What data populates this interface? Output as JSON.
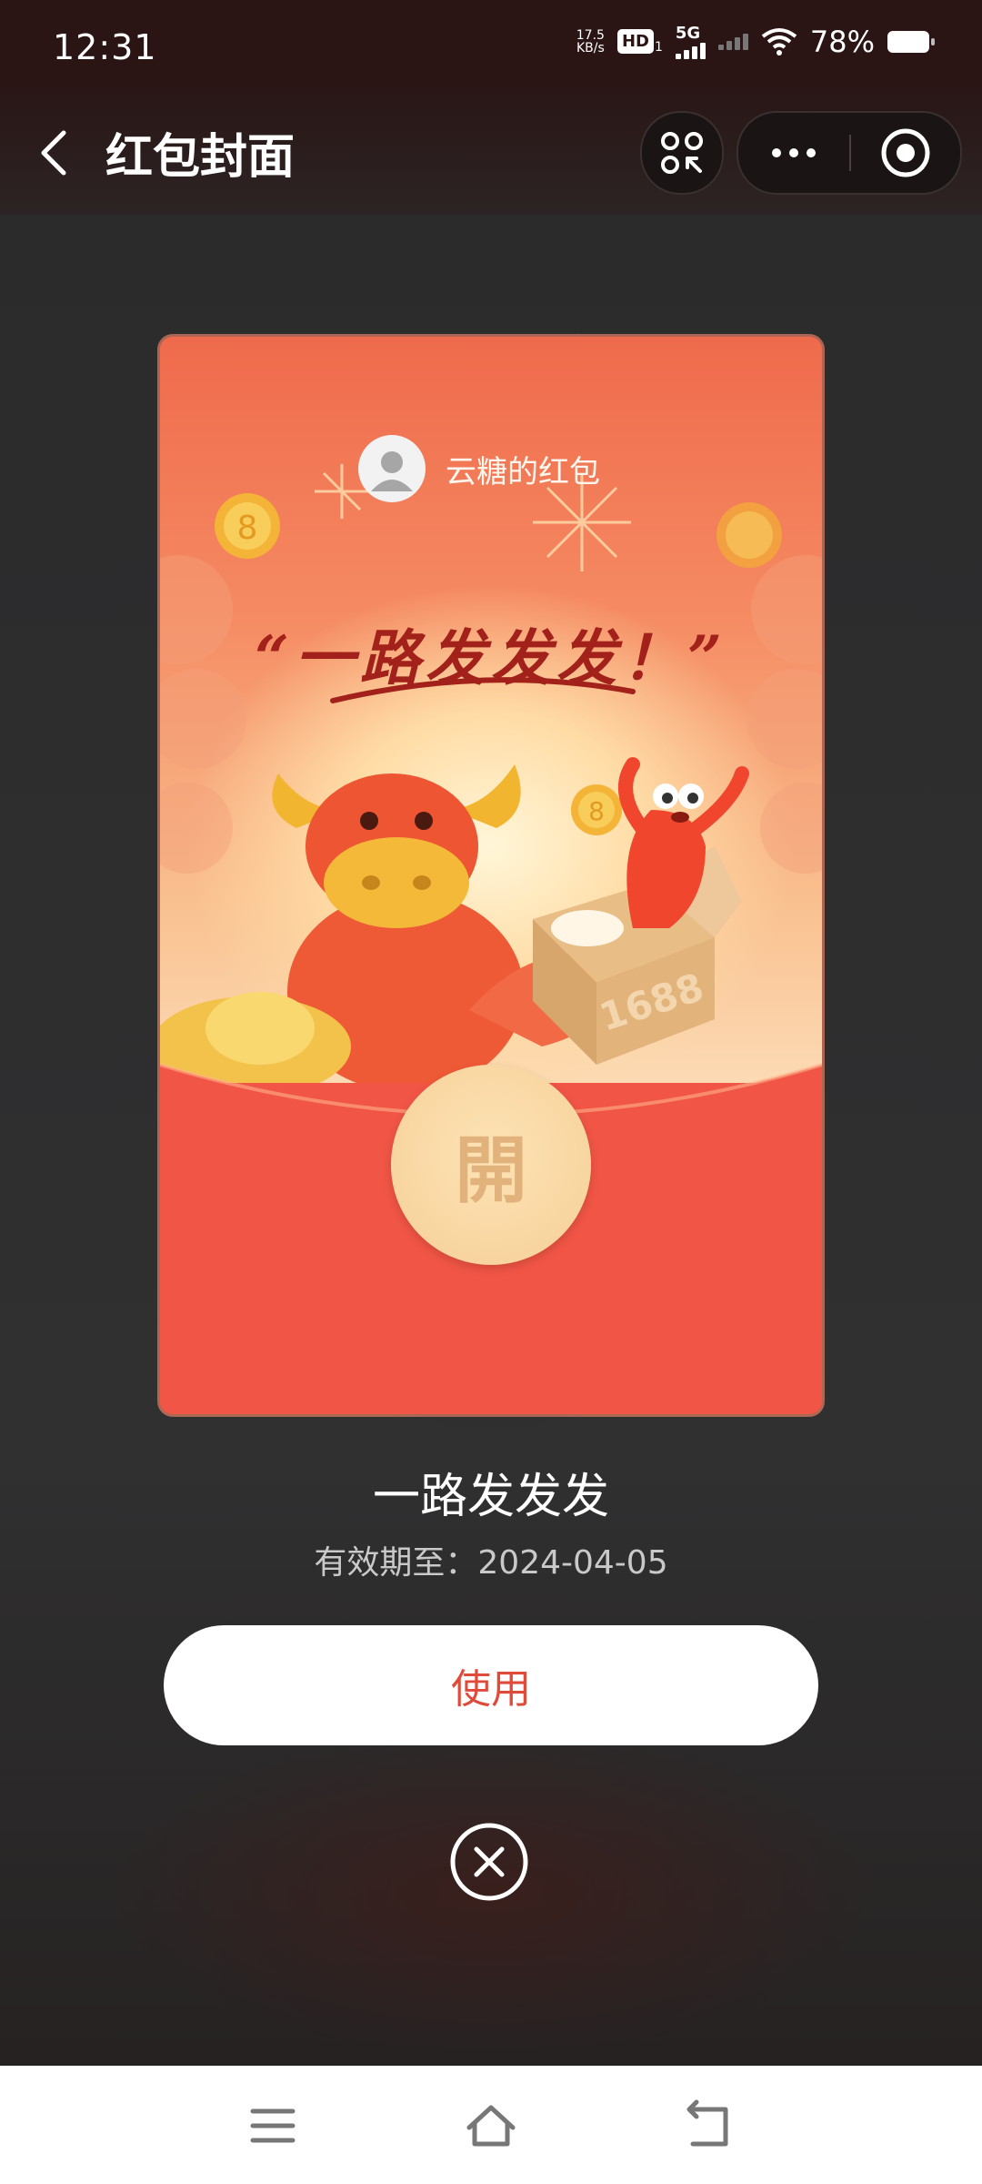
{
  "status_bar": {
    "time": "12:31",
    "net_speed_value": "17.5",
    "net_speed_unit": "KB/s",
    "hd_label": "HD",
    "hd_sub": "1",
    "network": "5G",
    "battery": "78%"
  },
  "nav": {
    "title": "红包封面"
  },
  "envelope": {
    "sender_name": "云糖的红包",
    "slogan": "“一路发发发！”",
    "box_text": "1688",
    "open_label": "開"
  },
  "info": {
    "cover_name": "一路发发发",
    "expiry": "有效期至：2024-04-05"
  },
  "actions": {
    "use_label": "使用"
  },
  "colors": {
    "accent_red": "#f15545",
    "button_text": "#e04a3a"
  }
}
